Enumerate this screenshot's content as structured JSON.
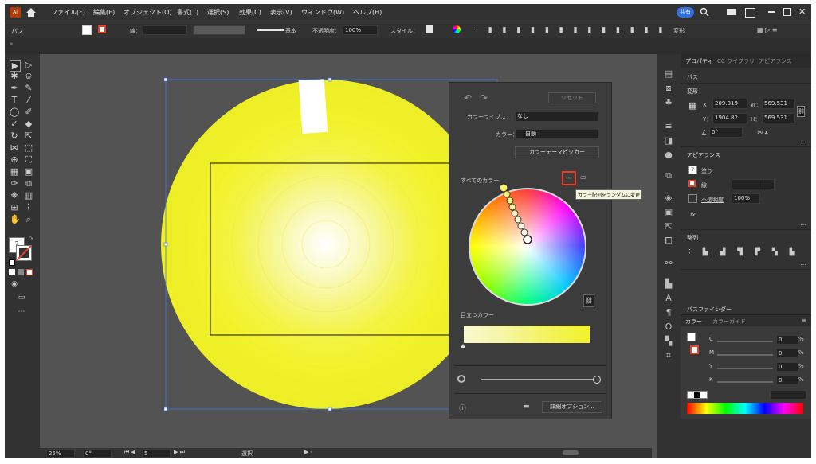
{
  "menubar": {
    "app_icon": "Ai",
    "items": [
      "ファイル(F)",
      "編集(E)",
      "オブジェクト(O)",
      "書式(T)",
      "選択(S)",
      "効果(C)",
      "表示(V)",
      "ウィンドウ(W)",
      "ヘルプ(H)"
    ],
    "share_label": "共有"
  },
  "control_bar": {
    "object_type": "パス",
    "stroke_label": "線：",
    "stroke_style": "基本",
    "opacity_label": "不透明度：",
    "opacity_value": "100%",
    "style_label": "スタイル：",
    "transform_label": "変形"
  },
  "guide_panel": {
    "reset_label": "リセット",
    "library_label": "カラーライブ...",
    "library_value": "なし",
    "colors_label": "カラー：",
    "colors_value": "自動",
    "theme_picker_label": "カラーテーマピッカー",
    "all_colors_label": "すべてのカラー",
    "tooltip": "カラー配列をランダムに変更",
    "prominent_label": "目立つカラー",
    "options_label": "詳細オプション..."
  },
  "properties": {
    "tabs": [
      "プロパティ",
      "CC ライブラリ",
      "アピアランス"
    ],
    "object_type": "パス",
    "transform_label": "変形",
    "x_label": "X：",
    "x_value": "209.319",
    "y_label": "Y：",
    "y_value": "1904.82",
    "w_label": "W：",
    "w_value": "569.531",
    "h_label": "H：",
    "h_value": "569.531",
    "angle_value": "0°",
    "appearance_label": "アピアランス",
    "fill_label": "塗り",
    "stroke_label": "線",
    "opacity_label": "不透明度",
    "opacity_value": "100%",
    "fx_label": "fx.",
    "align_label": "整列",
    "pathfinder_label": "パスファインダー",
    "color_tab": "カラー",
    "color_guide_tab": "カラーガイド",
    "channels": [
      {
        "name": "C",
        "value": "0",
        "unit": "%"
      },
      {
        "name": "M",
        "value": "0",
        "unit": "%"
      },
      {
        "name": "Y",
        "value": "0",
        "unit": "%"
      },
      {
        "name": "K",
        "value": "0",
        "unit": "%"
      }
    ]
  },
  "status": {
    "zoom": "25%",
    "rotation": "0°",
    "artboard": "5",
    "mode": "選択"
  },
  "colors": {
    "accent_yellow": "#f2f22a",
    "ui_dark": "#323232",
    "canvas": "#535353",
    "highlight_red": "#e8402a",
    "selection_blue": "#3a78f0"
  }
}
